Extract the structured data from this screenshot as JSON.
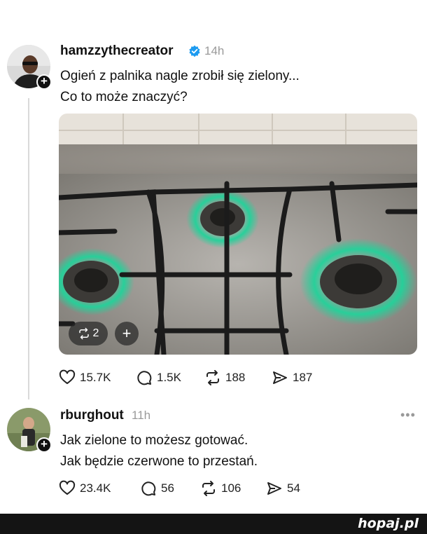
{
  "post": {
    "username": "hamzzythecreator",
    "time": "14h",
    "lines": [
      "Ogień z palnika nagle zrobił się zielony...",
      "Co to może znaczyć?"
    ],
    "media": {
      "carousel_count": "2",
      "add_label": "+"
    },
    "stats": {
      "likes": "15.7K",
      "comments": "1.5K",
      "reposts": "188",
      "shares": "187"
    }
  },
  "reply": {
    "username": "rburghout",
    "time": "11h",
    "lines": [
      "Jak zielone to możesz gotować.",
      "Jak będzie czerwone to przestań."
    ],
    "stats": {
      "likes": "23.4K",
      "comments": "56",
      "reposts": "106",
      "shares": "54"
    },
    "more": "•••"
  },
  "footer": {
    "brand": "hopaj.pl"
  },
  "colors": {
    "verified": "#1d9bf0",
    "flame": "#22d29a",
    "footer_bg": "#141414"
  }
}
